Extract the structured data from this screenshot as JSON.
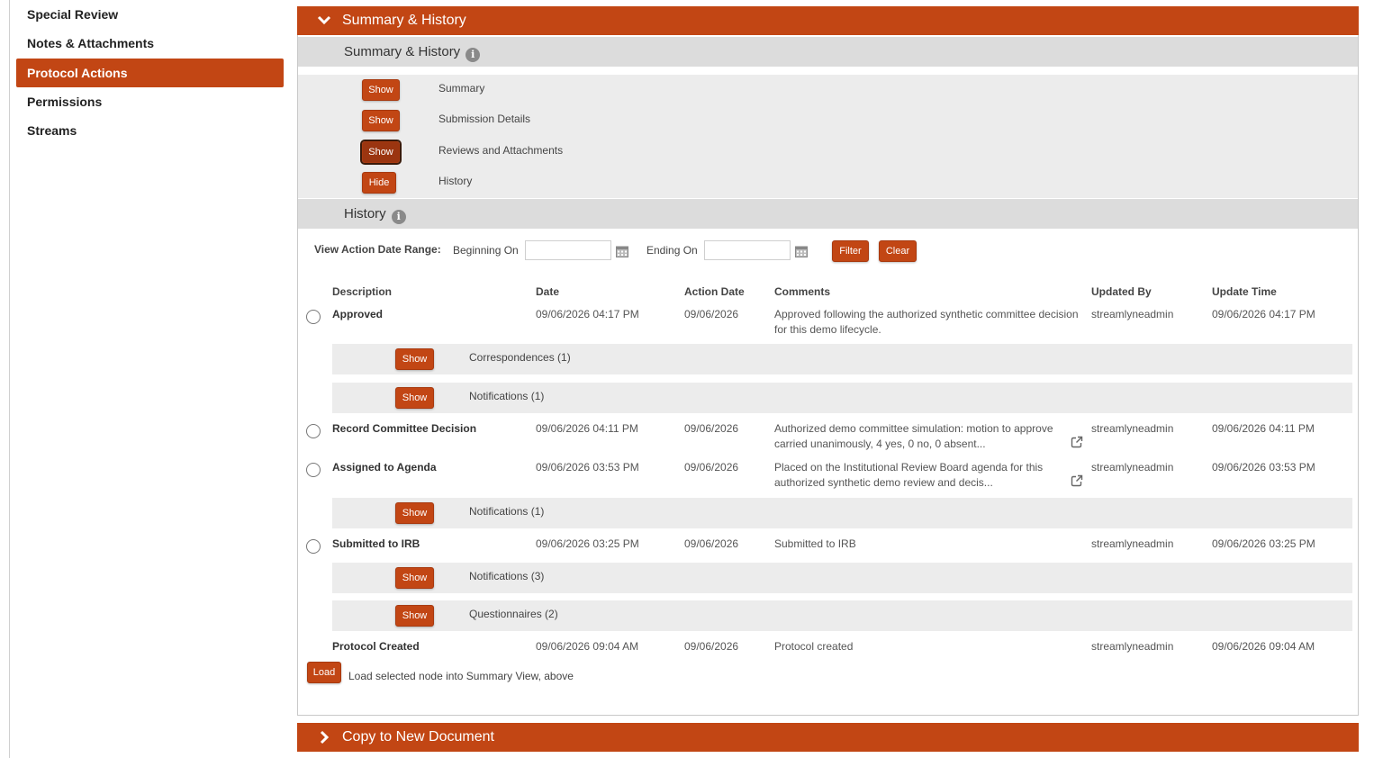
{
  "nav": {
    "items": [
      {
        "label": "Special Review",
        "active": false
      },
      {
        "label": "Notes & Attachments",
        "active": false
      },
      {
        "label": "Protocol Actions",
        "active": true
      },
      {
        "label": "Permissions",
        "active": false
      },
      {
        "label": "Streams",
        "active": false
      }
    ]
  },
  "summary_history": {
    "header": "Summary & History",
    "subheader": "Summary & History",
    "toggles": [
      {
        "button": "Show",
        "label": "Summary"
      },
      {
        "button": "Show",
        "label": "Submission Details"
      },
      {
        "button": "Show",
        "label": "Reviews and Attachments"
      },
      {
        "button": "Hide",
        "label": "History"
      }
    ]
  },
  "history": {
    "subheader": "History",
    "filter": {
      "range_label": "View Action Date Range:",
      "beginning_label": "Beginning On",
      "beginning_value": "",
      "ending_label": "Ending On",
      "ending_value": "",
      "filter_button": "Filter",
      "clear_button": "Clear"
    },
    "columns": [
      "Description",
      "Date",
      "Action Date",
      "Comments",
      "Updated By",
      "Update Time"
    ],
    "rows": [
      {
        "description": "Approved",
        "date": "09/06/2026 04:17 PM",
        "action_date": "09/06/2026",
        "comment_line1": "Approved following the authorized synthetic committee decision",
        "comment_line2": "for this demo lifecycle.",
        "updated_by": "streamlyneadmin",
        "update_time": "09/06/2026 04:17 PM"
      },
      {
        "description": "Record Committee Decision",
        "date": "09/06/2026 04:11 PM",
        "action_date": "09/06/2026",
        "comment_line1": "Authorized demo committee simulation: motion to approve",
        "comment_line2": "carried unanimously, 4 yes, 0 no, 0 absent...",
        "updated_by": "streamlyneadmin",
        "update_time": "09/06/2026 04:11 PM"
      },
      {
        "description": "Assigned to Agenda",
        "date": "09/06/2026 03:53 PM",
        "action_date": "09/06/2026",
        "comment_line1": "Placed on the Institutional Review Board agenda for this",
        "comment_line2": "authorized synthetic demo review and decis...",
        "updated_by": "streamlyneadmin",
        "update_time": "09/06/2026 03:53 PM"
      },
      {
        "description": "Submitted to IRB",
        "date": "09/06/2026 03:25 PM",
        "action_date": "09/06/2026",
        "comment_line1": "Submitted to IRB",
        "comment_line2": "",
        "updated_by": "streamlyneadmin",
        "update_time": "09/06/2026 03:25 PM"
      },
      {
        "description": "Protocol Created",
        "date": "09/06/2026 09:04 AM",
        "action_date": "09/06/2026",
        "comment_line1": "Protocol created",
        "comment_line2": "",
        "updated_by": "streamlyneadmin",
        "update_time": "09/06/2026 09:04 AM"
      }
    ],
    "subrows": [
      {
        "button": "Show",
        "label": "Correspondences (1)"
      },
      {
        "button": "Show",
        "label": "Notifications (1)"
      },
      {
        "button": "Show",
        "label": "Notifications (1)"
      },
      {
        "button": "Show",
        "label": "Notifications (3)"
      },
      {
        "button": "Show",
        "label": "Questionnaires (2)"
      }
    ],
    "load_button": "Load",
    "load_label": "Load selected node into Summary View, above"
  },
  "copy_section": {
    "header": "Copy to New Document"
  },
  "colors": {
    "accent": "#c24614",
    "subheader_bg": "#dcdcdc",
    "row_bg": "#ececec"
  }
}
